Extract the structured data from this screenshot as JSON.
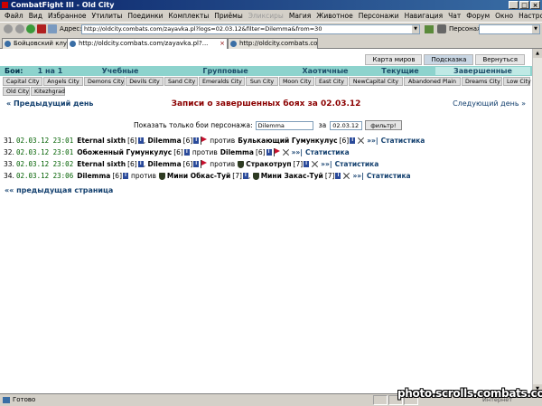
{
  "window": {
    "title": "CombatFight III - Old City",
    "controls": [
      "_",
      "□",
      "×"
    ]
  },
  "menu": [
    "Файл",
    "Вид",
    "Избранное",
    "Утилиты",
    "Поединки",
    "Комплекты",
    "Приёмы",
    "Эликсиры",
    "Магия",
    "Животное",
    "Персонажи",
    "Навигация",
    "Чат",
    "Форум",
    "Окно",
    "Настройки"
  ],
  "toolbar": {
    "address_label": "Адрес:",
    "address_value": "http://oldcity.combats.com/zayavka.pl?logs=02.03.12&filter=Dilemma&from=30",
    "person_label": "Персонаж:"
  },
  "tabs": [
    {
      "label": "Бойцовский клуб",
      "active": false
    },
    {
      "label": "http://oldcity.combats.com/zayavka.pl?...",
      "active": true
    },
    {
      "label": "http://oldcity.combats.com/logs.pl?log...",
      "active": false
    }
  ],
  "page": {
    "top_buttons": [
      {
        "label": "Карта миров",
        "selected": false
      },
      {
        "label": "Подсказка",
        "selected": true
      },
      {
        "label": "Вернуться",
        "selected": false
      }
    ],
    "fights_label": "Бои:",
    "fight_tabs": [
      {
        "label": "1 на 1",
        "width": 55,
        "active": false
      },
      {
        "label": "Учебные",
        "width": 100,
        "active": false
      },
      {
        "label": "Групповые",
        "width": 133,
        "active": false
      },
      {
        "label": "Хаотичные",
        "width": 88,
        "active": false
      },
      {
        "label": "Текущие",
        "width": 78,
        "active": false
      },
      {
        "label": "Завершенные",
        "width": 105,
        "active": true
      }
    ],
    "cities": [
      "Capital City",
      "Angels City",
      "Demons City",
      "Devils City",
      "Sand City",
      "Emeralds City",
      "Sun City",
      "Moon City",
      "East City",
      "NewCapital City",
      "Abandoned Plain",
      "Dreams City",
      "Low City",
      "Old City",
      "Kitezhgrad"
    ],
    "prev_day": "« Предыдущий день",
    "title": "Записи о завершенных боях за 02.03.12",
    "next_day": "Следующий день »",
    "filter": {
      "label": "Показать только бои персонажа:",
      "name_value": "Dilemma",
      "date_label": "за",
      "date_value": "02.03.12",
      "button": "фильтр!"
    },
    "fights": [
      {
        "num": "31.",
        "time": "02.03.12 23:01",
        "side_a": [
          {
            "name": "Eternal sixth",
            "level": "[6]",
            "flag": false
          },
          {
            "name": "Dilemma",
            "level": "[6]",
            "flag": true
          }
        ],
        "vs": "против",
        "side_b": [
          {
            "name": "Булькающий Гумункулус",
            "level": "[6]",
            "shield": false
          }
        ],
        "stat": "Статистика"
      },
      {
        "num": "32.",
        "time": "02.03.12 23:01",
        "side_a": [
          {
            "name": "Обоженный Гумункулус",
            "level": "[6]",
            "flag": false
          }
        ],
        "vs": "против",
        "side_b": [
          {
            "name": "Dilemma",
            "level": "[6]",
            "shield": false,
            "flag": true
          }
        ],
        "stat": "Статистика"
      },
      {
        "num": "33.",
        "time": "02.03.12 23:02",
        "side_a": [
          {
            "name": "Eternal sixth",
            "level": "[6]",
            "flag": false
          },
          {
            "name": "Dilemma",
            "level": "[6]",
            "flag": true
          }
        ],
        "vs": "против",
        "side_b": [
          {
            "name": "Стракотруп",
            "level": "[7]",
            "shield": true
          }
        ],
        "stat": "Статистика"
      },
      {
        "num": "34.",
        "time": "02.03.12 23:06",
        "side_a": [
          {
            "name": "Dilemma",
            "level": "[6]",
            "flag": false
          }
        ],
        "vs": "против",
        "side_b": [
          {
            "name": "Мини Обкас-Туй",
            "level": "[7]",
            "shield": true
          },
          {
            "name": "Мини Закас-Туй",
            "level": "[7]",
            "shield": true
          }
        ],
        "stat": "Статистика"
      }
    ],
    "arrows": "»»|",
    "prev_page": "«« предыдущая страница"
  },
  "status": {
    "text": "Готово",
    "zone": "Интернет"
  },
  "watermark": "photo.scrolls.combats.com",
  "colors": {
    "fights_bar": "#8dd3cd",
    "title_red": "#8b0000",
    "link_blue": "#123f6e",
    "date_green": "#006000"
  }
}
